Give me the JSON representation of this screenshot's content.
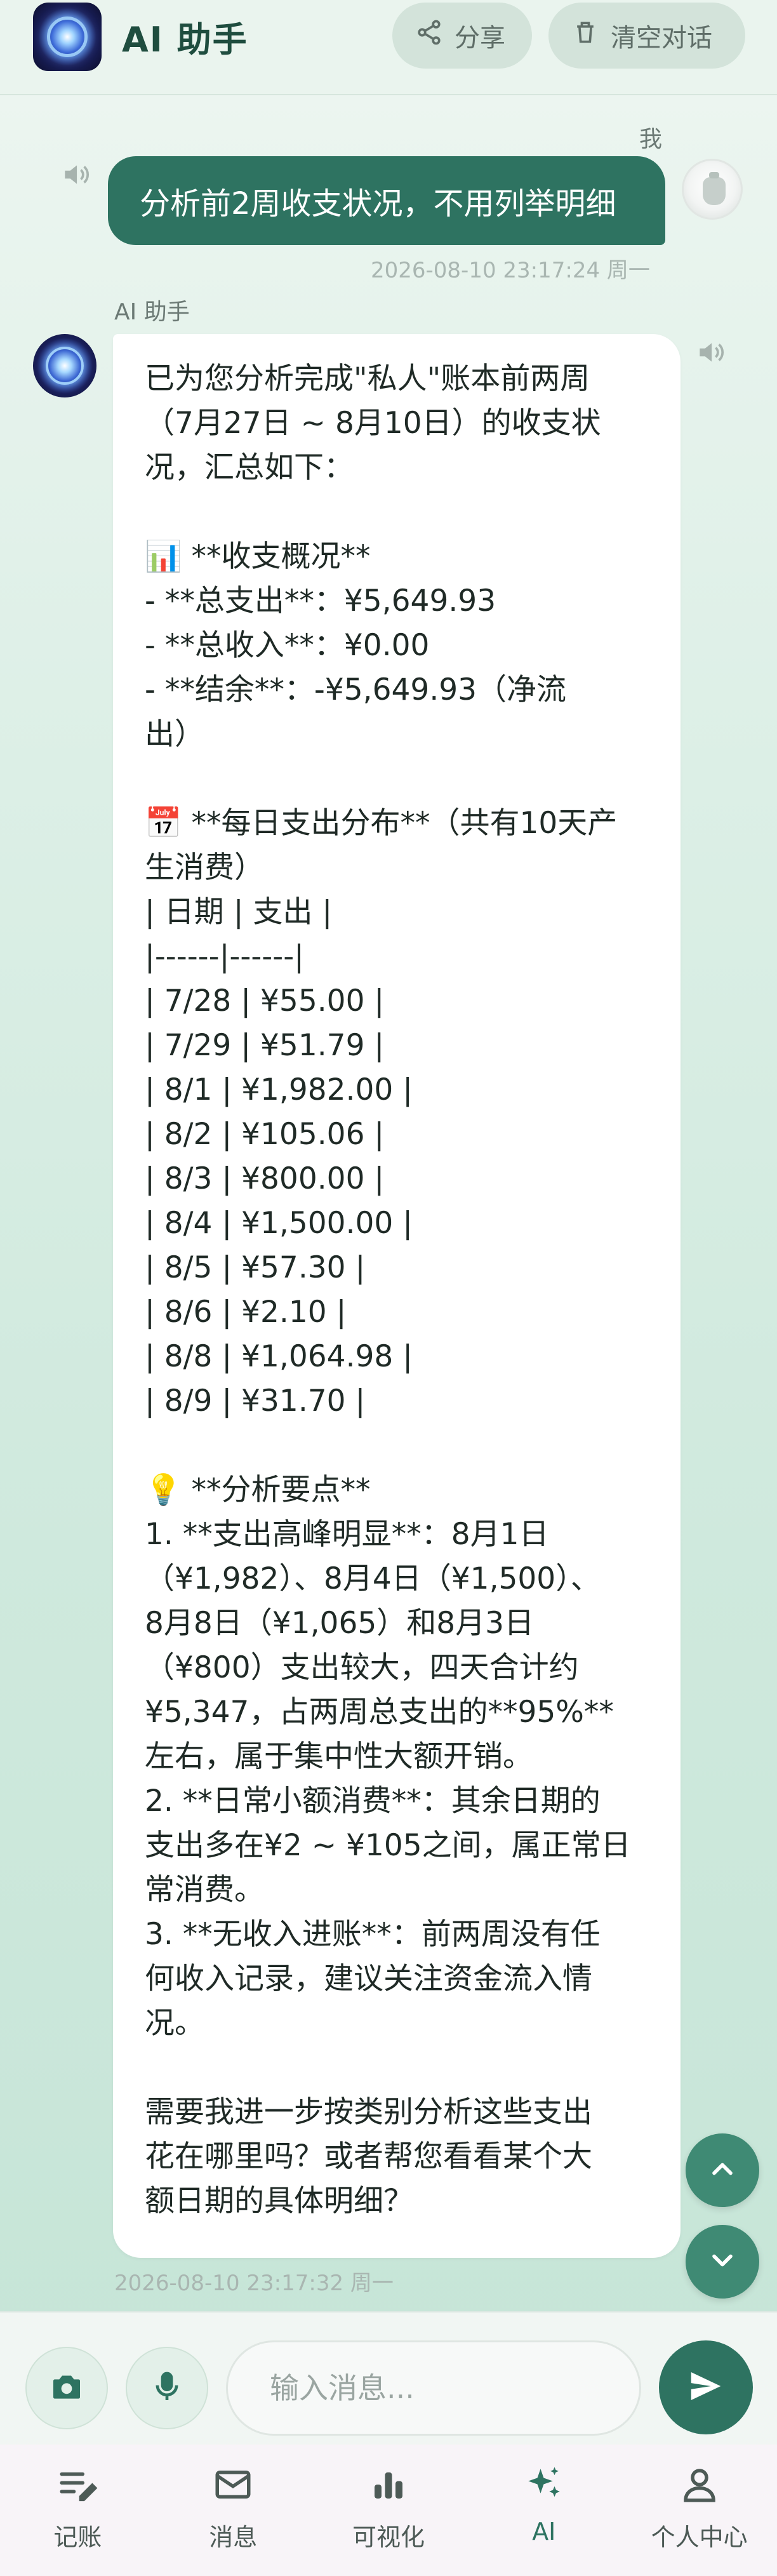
{
  "header": {
    "title": "AI 助手",
    "share_label": "分享",
    "clear_label": "清空对话"
  },
  "user_message": {
    "sender": "我",
    "text": "分析前2周收支状况，不用列举明细",
    "timestamp": "2026-08-10 23:17:24 周一"
  },
  "ai_message": {
    "sender": "AI 助手",
    "lines": [
      "已为您分析完成\"私人\"账本前两周",
      "（7月27日 ~ 8月10日）的收支状",
      "况，汇总如下：",
      "",
      "📊 **收支概况**",
      "- **总支出**：¥5,649.93",
      "- **总收入**：¥0.00",
      "- **结余**：-¥5,649.93（净流",
      "出）",
      "",
      "📅 **每日支出分布**（共有10天产",
      "生消费）",
      "| 日期 | 支出 |",
      "|------|------|",
      "| 7/28 | ¥55.00 |",
      "| 7/29 | ¥51.79 |",
      "| 8/1 | ¥1,982.00 |",
      "| 8/2 | ¥105.06 |",
      "| 8/3 | ¥800.00 |",
      "| 8/4 | ¥1,500.00 |",
      "| 8/5 | ¥57.30 |",
      "| 8/6 | ¥2.10 |",
      "| 8/8 | ¥1,064.98 |",
      "| 8/9 | ¥31.70 |",
      "",
      "💡 **分析要点**",
      "1. **支出高峰明显**：8月1日",
      "（¥1,982）、8月4日（¥1,500）、",
      "8月8日（¥1,065）和8月3日",
      "（¥800）支出较大，四天合计约",
      "¥5,347，占两周总支出的**95%**",
      "左右，属于集中性大额开销。",
      "2. **日常小额消费**：其余日期的",
      "支出多在¥2 ~ ¥105之间，属正常日",
      "常消费。",
      "3. **无收入进账**：前两周没有任",
      "何收入记录，建议关注资金流入情",
      "况。",
      "",
      "需要我进一步按类别分析这些支出",
      "花在哪里吗？或者帮您看看某个大",
      "额日期的具体明细？"
    ],
    "timestamp": "2026-08-10 23:17:32 周一"
  },
  "input": {
    "placeholder": "输入消息..."
  },
  "nav": {
    "items": [
      {
        "label": "记账",
        "icon": "edit-list-icon"
      },
      {
        "label": "消息",
        "icon": "mail-icon"
      },
      {
        "label": "可视化",
        "icon": "bar-chart-icon"
      },
      {
        "label": "AI",
        "icon": "sparkle-icon",
        "active": true
      },
      {
        "label": "个人中心",
        "icon": "person-icon"
      }
    ]
  },
  "colors": {
    "accent": "#2e7361",
    "fab": "#3f8a74",
    "background": "#dcefe6"
  }
}
